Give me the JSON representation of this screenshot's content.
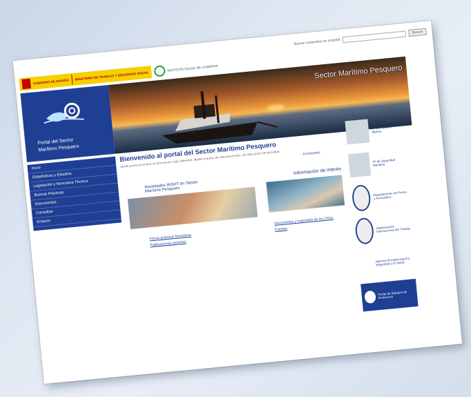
{
  "header": {
    "search_label": "Buscar contenidos en el portal",
    "search_placeholder": "",
    "search_button": "Buscar"
  },
  "logos": {
    "gov_text": "GOBIERNO DE ESPAÑA",
    "ministry_text": "MINISTERIO DE TRABAJO Y SEGURIDAD SOCIAL",
    "institute_text": "INSTITUTO SOCIAL DE LA MARINA"
  },
  "banner": {
    "title": "Sector Marítimo Pesquero",
    "portal_line1": "Portal del Sector",
    "portal_line2": "Marítimo Pesquero"
  },
  "nav": {
    "items": [
      "Inicio",
      "Estadísticas y Estudios",
      "Legislación y Normativa Técnica",
      "Buenas Prácticas",
      "Documentos",
      "Consultas",
      "Enlaces"
    ]
  },
  "welcome": {
    "title": "Bienvenido al portal del Sector Marítimo Pesquero",
    "text": "donde podrá encontrar la información más relevante, desde el punto de vista preventivo, de este sector de actividad.",
    "more": "Conócenos"
  },
  "news": {
    "heading_line1": "Novedades INSHT en Sector",
    "heading_line2": "Marítimo Pesquero",
    "links": [
      "Fichas prácticas formativas",
      "Publicaciones recientes"
    ]
  },
  "info": {
    "heading": "Información de interés",
    "links": [
      "Documentos y materiales de los CNCs",
      "Fuentes"
    ]
  },
  "rail": {
    "cards": [
      "Nº de Puestos Marina",
      "Nº de Seguridad Marítima",
      "Departamento de Pesca y Acuicultura",
      "Organización Internacional del Trabajo",
      "Agencia Europea para la Seguridad y la Salud",
      "Portal de Equipos de Protección"
    ]
  }
}
